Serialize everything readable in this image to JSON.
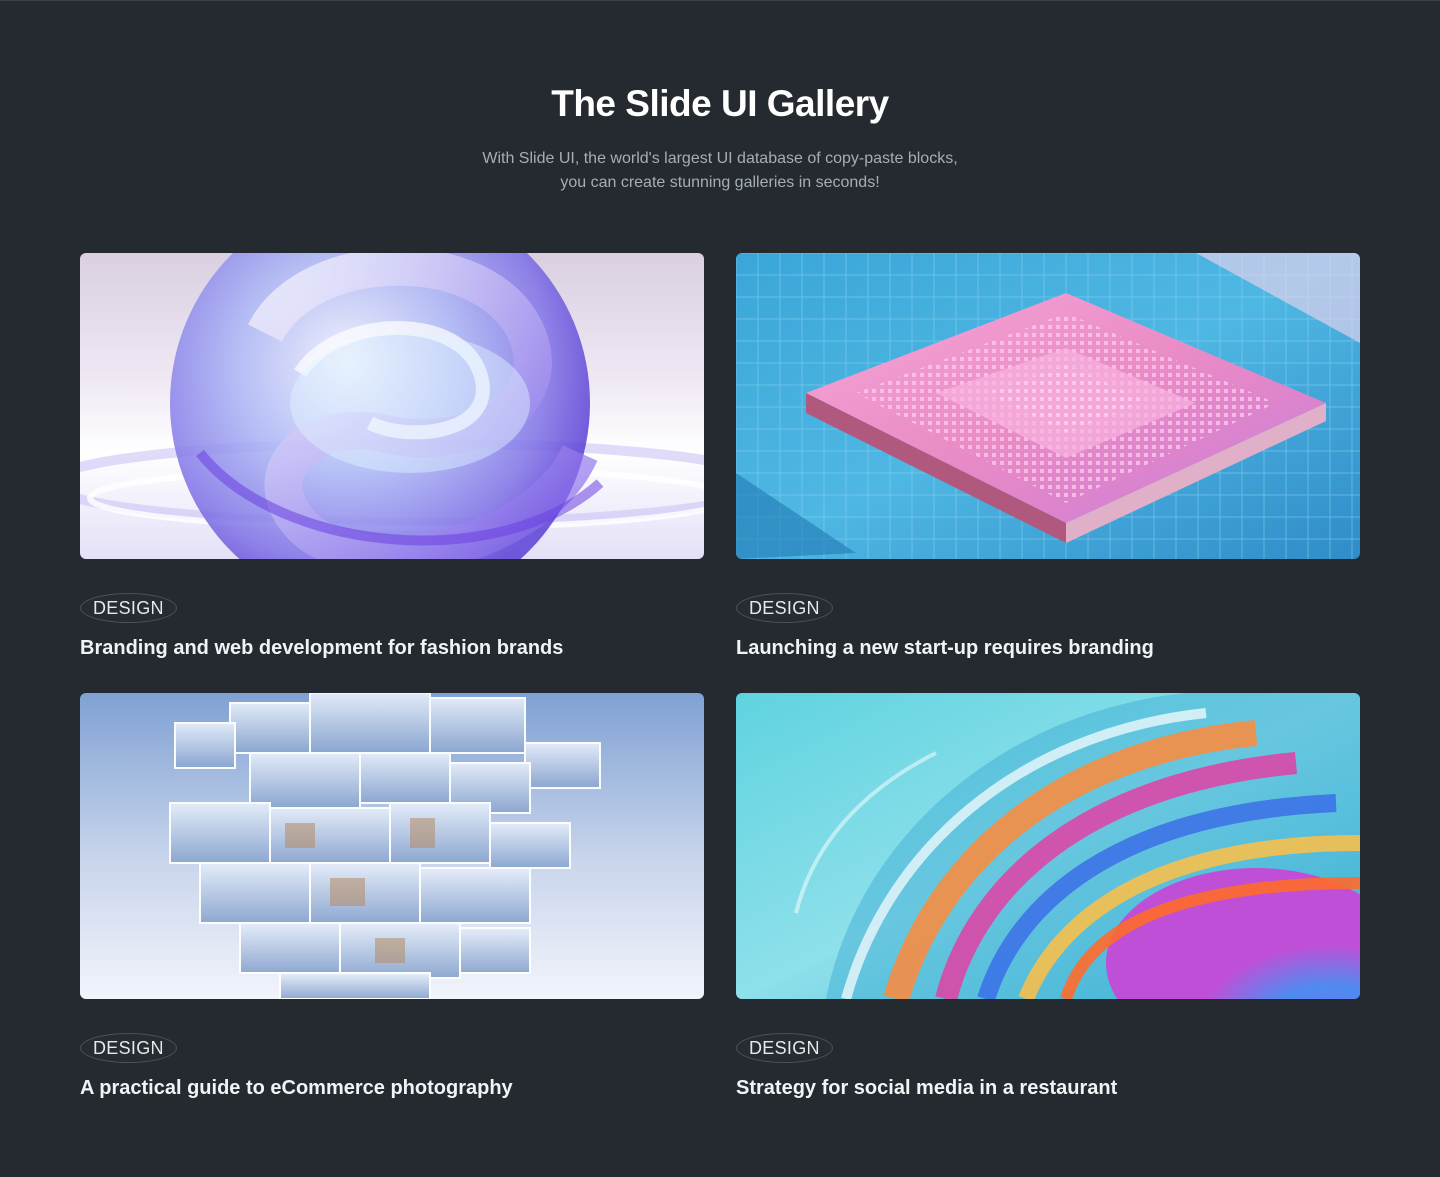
{
  "header": {
    "title": "The Slide UI Gallery",
    "subtitle_line1": "With Slide UI, the world's largest UI database of copy-paste blocks,",
    "subtitle_line2": "you can create stunning galleries in seconds!"
  },
  "cards": [
    {
      "tag": "DESIGN",
      "title": "Branding and web development for fashion brands",
      "image": "glass-sphere-image"
    },
    {
      "tag": "DESIGN",
      "title": "Launching a new start-up requires branding",
      "image": "microchip-image"
    },
    {
      "tag": "DESIGN",
      "title": "A practical guide to eCommerce photography",
      "image": "glass-cubes-image"
    },
    {
      "tag": "DESIGN",
      "title": "Strategy for social media in a restaurant",
      "image": "iridescent-swirl-image"
    }
  ],
  "colors": {
    "background": "#242a30",
    "title": "#ffffff",
    "subtitle": "#a7adb5",
    "tag_border": "#4b525a"
  }
}
